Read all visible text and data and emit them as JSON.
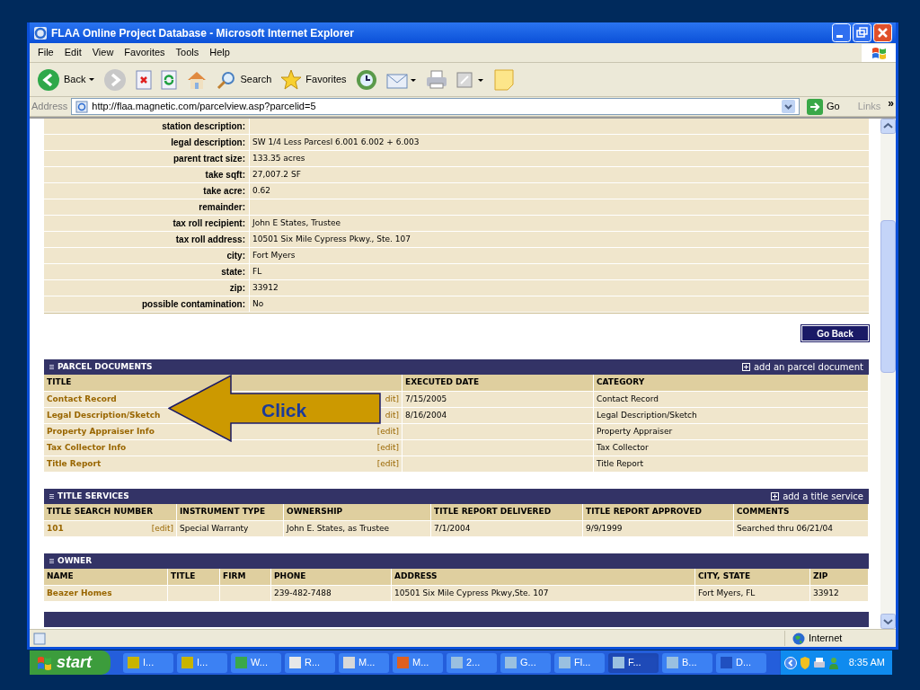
{
  "window": {
    "title": "FLAA Online Project Database - Microsoft Internet Explorer"
  },
  "menu": [
    "File",
    "Edit",
    "View",
    "Favorites",
    "Tools",
    "Help"
  ],
  "toolbar": [
    {
      "kind": "back",
      "label": "Back"
    },
    {
      "kind": "forward"
    },
    {
      "kind": "stop"
    },
    {
      "kind": "refresh"
    },
    {
      "kind": "home"
    },
    {
      "kind": "search",
      "label": "Search"
    },
    {
      "kind": "favorites",
      "label": "Favorites"
    },
    {
      "kind": "history"
    },
    {
      "kind": "mail"
    },
    {
      "kind": "print"
    },
    {
      "kind": "edit"
    },
    {
      "kind": "note"
    }
  ],
  "address_bar": {
    "label": "Address",
    "url": "http://flaa.magnetic.com/parcelview.asp?parcelid=5",
    "go": "Go",
    "links": "Links",
    "more": "»"
  },
  "properties": [
    {
      "label": "station description:"
    },
    {
      "label": "legal description:",
      "value": "SW 1/4 Less Parcesl 6.001 6.002 + 6.003"
    },
    {
      "label": "parent tract size:",
      "value": "133.35 acres"
    },
    {
      "label": "take sqft:",
      "value": "27,007.2 SF"
    },
    {
      "label": "take acre:",
      "value": "0.62"
    },
    {
      "label": "remainder:"
    },
    {
      "label": "tax roll recipient:",
      "value": "John E States, Trustee"
    },
    {
      "label": "tax roll address:",
      "value": "10501 Six Mile Cypress Pkwy., Ste. 107"
    },
    {
      "label": "city:",
      "value": "Fort Myers"
    },
    {
      "label": "state:",
      "value": "FL"
    },
    {
      "label": "zip:",
      "value": "33912"
    },
    {
      "label": "possible contamination:",
      "value": "No"
    }
  ],
  "go_back": "Go Back",
  "sections": [
    {
      "title": "PARCEL DOCUMENTS",
      "action": "add an parcel document",
      "columns": [
        "TITLE",
        "EXECUTED DATE",
        "CATEGORY"
      ],
      "rows": [
        [
          {
            "text": "Contact Record",
            "kind": "link",
            "edit": "dit]"
          },
          {
            "text": "7/15/2005",
            "kind": "text"
          },
          {
            "text": "Contact Record",
            "kind": "text"
          }
        ],
        [
          {
            "text": "Legal Description/Sketch",
            "kind": "link",
            "edit": "dit]"
          },
          {
            "text": "8/16/2004",
            "kind": "text"
          },
          {
            "text": "Legal Description/Sketch",
            "kind": "text"
          }
        ],
        [
          {
            "text": "Property Appraiser Info",
            "kind": "link",
            "edit": "[edit]"
          },
          {
            "kind": "empty"
          },
          {
            "text": "Property Appraiser",
            "kind": "text"
          }
        ],
        [
          {
            "text": "Tax Collector Info",
            "kind": "link",
            "edit": "[edit]"
          },
          {
            "kind": "empty"
          },
          {
            "text": "Tax Collector",
            "kind": "text"
          }
        ],
        [
          {
            "text": "Title Report",
            "kind": "link",
            "edit": "[edit]"
          },
          {
            "kind": "empty"
          },
          {
            "text": "Title Report",
            "kind": "text"
          }
        ]
      ]
    },
    {
      "title": "TITLE SERVICES",
      "action": "add a title service",
      "columns": [
        "TITLE SEARCH NUMBER",
        "INSTRUMENT TYPE",
        "OWNERSHIP",
        "TITLE REPORT DELIVERED",
        "TITLE REPORT APPROVED",
        "COMMENTS"
      ],
      "rows": [
        [
          {
            "text": "101",
            "kind": "link",
            "edit": "[edit]"
          },
          {
            "text": "Special Warranty",
            "kind": "text"
          },
          {
            "text": "John E. States, as Trustee",
            "kind": "text"
          },
          {
            "text": "7/1/2004",
            "kind": "text"
          },
          {
            "text": "9/9/1999",
            "kind": "text"
          },
          {
            "text": "Searched thru 06/21/04",
            "kind": "text"
          }
        ]
      ]
    },
    {
      "title": "OWNER",
      "columns": [
        "NAME",
        "TITLE",
        "FIRM",
        "PHONE",
        "ADDRESS",
        "CITY, STATE",
        "ZIP"
      ],
      "rows": [
        [
          {
            "text": "Beazer Homes",
            "kind": "link"
          },
          {
            "kind": "empty"
          },
          {
            "kind": "empty"
          },
          {
            "text": "239-482-7488",
            "kind": "text"
          },
          {
            "text": "10501 Six Mile Cypress Pkwy,Ste. 107",
            "kind": "text"
          },
          {
            "text": "Fort Myers, FL",
            "kind": "text"
          },
          {
            "text": "33912",
            "kind": "text"
          }
        ]
      ]
    }
  ],
  "callout": "Click",
  "status_bar": {
    "zone": "Internet"
  },
  "taskbar": {
    "start": "start",
    "items": [
      {
        "label": "I...",
        "selected": false,
        "color": "#c8b400"
      },
      {
        "label": "I...",
        "selected": false,
        "color": "#c8b400"
      },
      {
        "label": "W...",
        "selected": false,
        "color": "#3aa84a"
      },
      {
        "label": "R...",
        "selected": false,
        "color": "#e8e8e8"
      },
      {
        "label": "M...",
        "selected": false,
        "color": "#d8d8d8"
      },
      {
        "label": "M...",
        "selected": false,
        "color": "#e06020"
      },
      {
        "label": "2...",
        "selected": false,
        "color": "#9ac0e0"
      },
      {
        "label": "G...",
        "selected": false,
        "color": "#9ac0e0"
      },
      {
        "label": "Fl...",
        "selected": false,
        "color": "#9ac0e0"
      },
      {
        "label": "F...",
        "selected": true,
        "color": "#9ac0e0"
      },
      {
        "label": "B...",
        "selected": false,
        "color": "#9ac0e0"
      },
      {
        "label": "D...",
        "selected": false,
        "color": "#2050c0"
      }
    ],
    "time": "8:35 AM"
  }
}
